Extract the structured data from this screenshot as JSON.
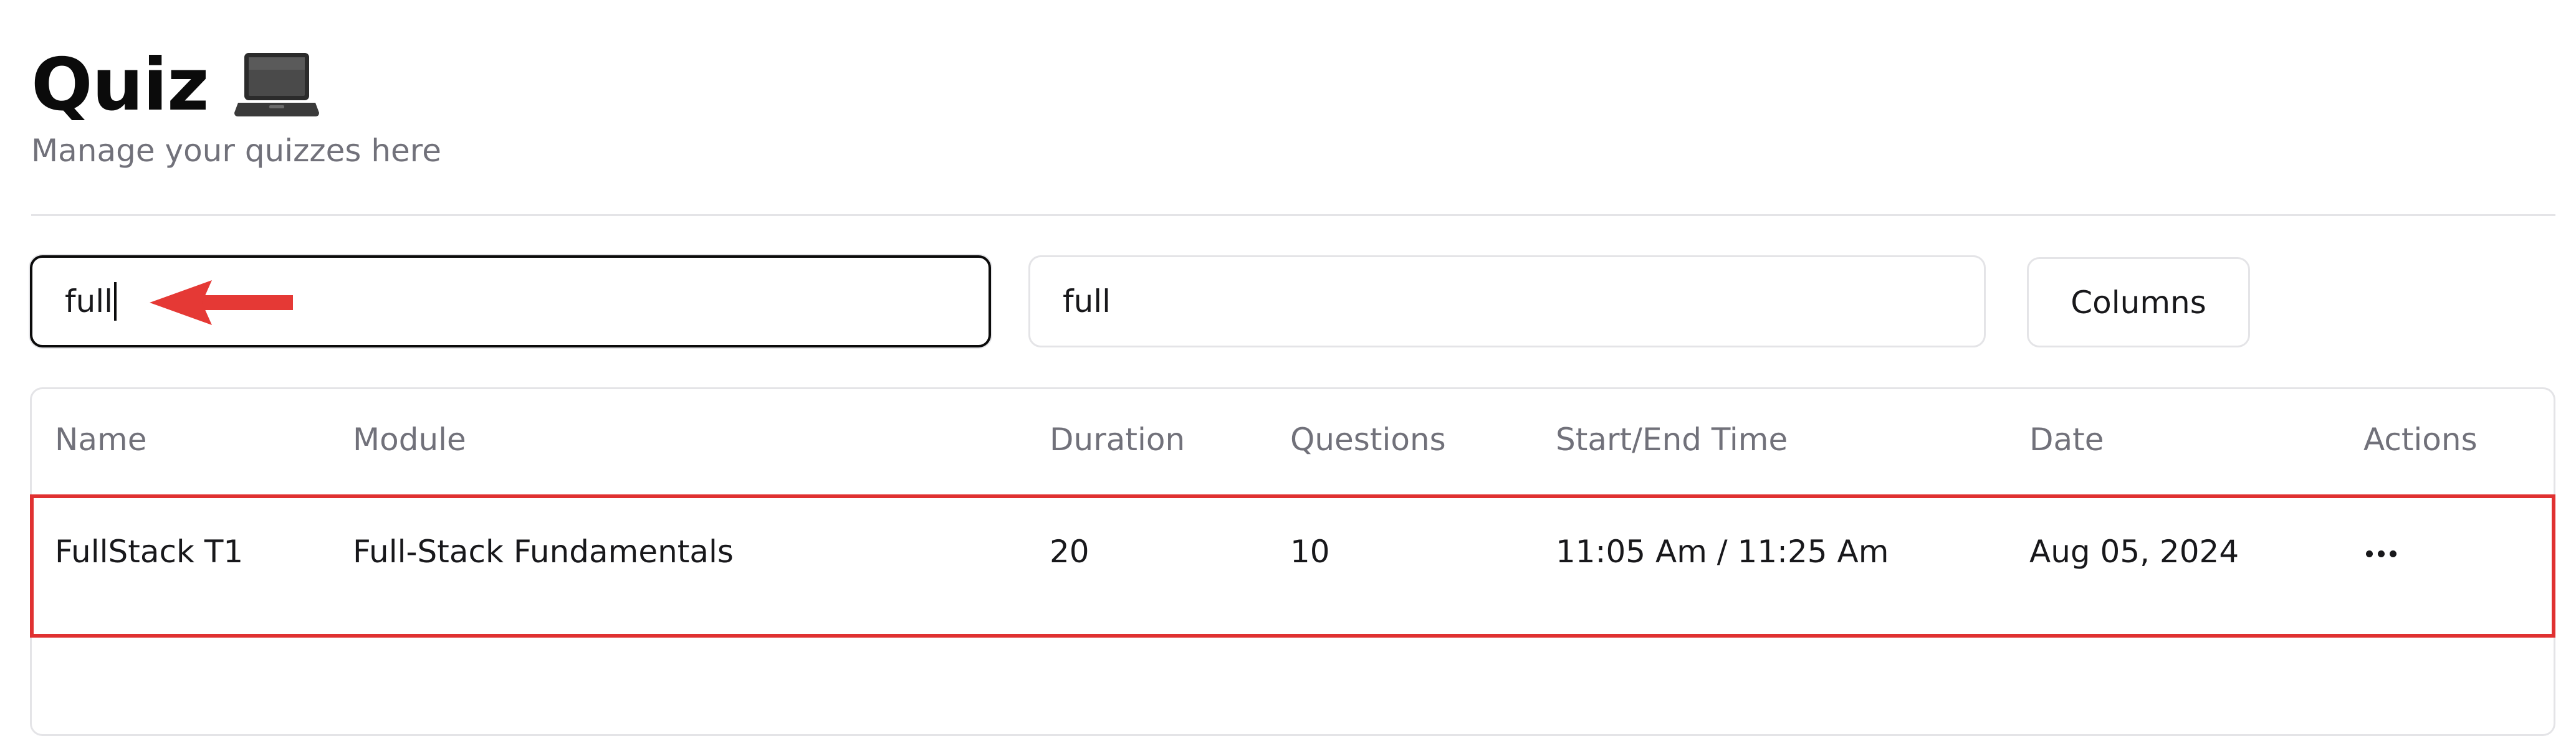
{
  "header": {
    "title": "Quiz",
    "title_icon": "laptop-icon",
    "subtitle": "Manage your quizzes here"
  },
  "filters": {
    "search_value": "full",
    "module_filter_value": "full",
    "columns_button_label": "Columns"
  },
  "annotation": {
    "arrow_color": "#e53935",
    "highlight_color": "#e03131"
  },
  "table": {
    "columns": [
      "Name",
      "Module",
      "Duration",
      "Questions",
      "Start/End Time",
      "Date",
      "Actions"
    ],
    "rows": [
      {
        "name": "FullStack T1",
        "module": "Full-Stack Fundamentals",
        "duration": "20",
        "questions": "10",
        "time": "11:05 Am / 11:25 Am",
        "date": "Aug 05, 2024",
        "actions_icon": "more-horizontal-icon"
      }
    ]
  }
}
